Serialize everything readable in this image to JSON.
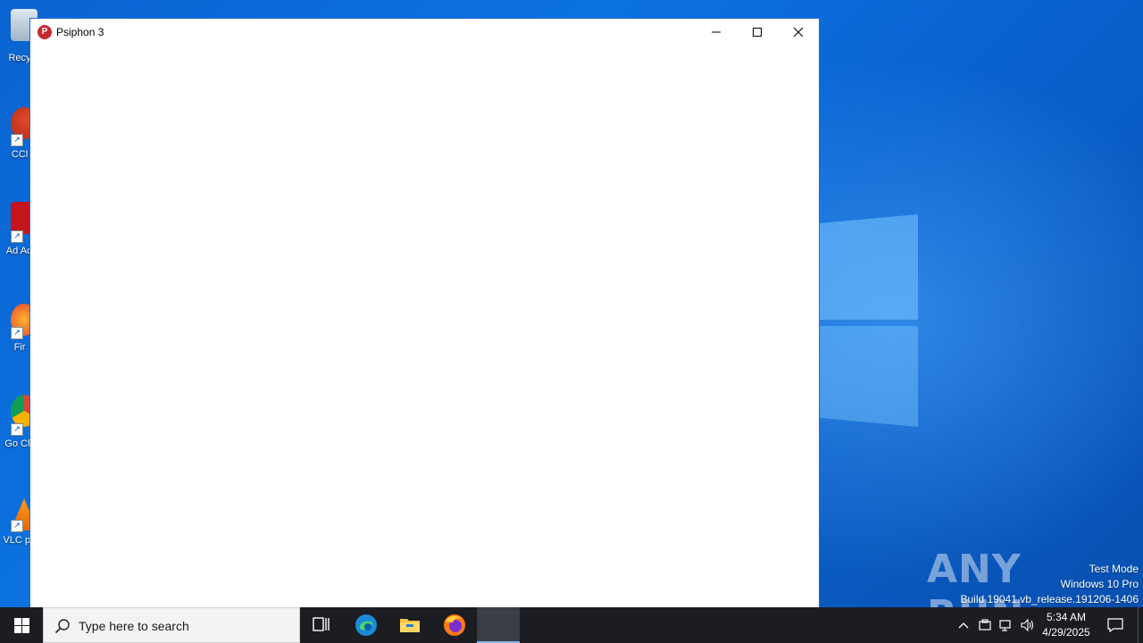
{
  "window": {
    "title": "Psiphon 3",
    "app_icon_letter": "P"
  },
  "desktop": {
    "icons": [
      {
        "label": "Recy",
        "icon": "recycle-bin-icon"
      },
      {
        "label": "CCl",
        "icon": "ccleaner-icon"
      },
      {
        "label": "Ad Acr",
        "icon": "adobe-acrobat-icon"
      },
      {
        "label": "Fir",
        "icon": "firefox-icon"
      },
      {
        "label": "Go Chr",
        "icon": "chrome-icon"
      },
      {
        "label": "VLC pla",
        "icon": "vlc-icon"
      }
    ]
  },
  "watermark": {
    "brand": "ANY RUN",
    "test_mode": "Test Mode",
    "os": "Windows 10 Pro",
    "build": "Build 19041.vb_release.191206-1406"
  },
  "taskbar": {
    "search_placeholder": "Type here to search",
    "pinned": [
      {
        "name": "task-view-icon"
      },
      {
        "name": "edge-icon"
      },
      {
        "name": "file-explorer-icon"
      },
      {
        "name": "firefox-icon"
      },
      {
        "name": "psiphon-taskbar-icon"
      }
    ],
    "clock": {
      "time": "5:34 AM",
      "date": "4/29/2025"
    }
  },
  "colors": {
    "desktop_blue": "#0a63d0",
    "taskbar": "#1b1d22",
    "psiphon_red": "#c8282d"
  }
}
